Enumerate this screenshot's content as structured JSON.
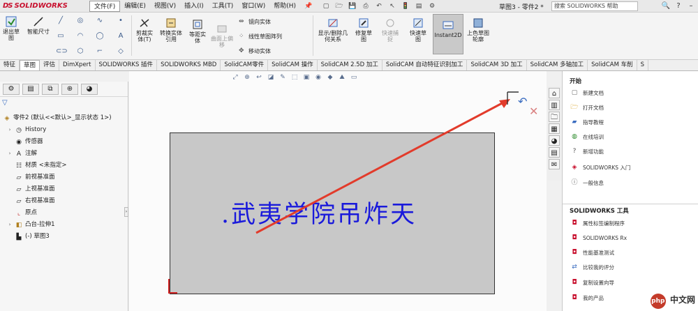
{
  "app": {
    "brand": "SOLIDWORKS",
    "brand_prefix": "DS"
  },
  "menubar": {
    "items": [
      "文件(F)",
      "编辑(E)",
      "视图(V)",
      "插入(I)",
      "工具(T)",
      "窗口(W)",
      "帮助(H)"
    ],
    "doc_title": "草图3 - 零件2 *",
    "search_placeholder": "搜索 SOLIDWORKS 帮助"
  },
  "ribbon": {
    "exit_sketch": "退出草图",
    "smart_dimension": "智能尺寸",
    "trim_entities": "剪裁实体(T)",
    "convert_entities": "转换实体引用",
    "offset_entities": "等距实体",
    "offset_on_surface": "曲面上偏移",
    "mirror_entities": "镜向实体",
    "linear_pattern": "线性草图阵列",
    "move_entities": "移动实体",
    "display_delete_relations": "显示/删除几何关系",
    "repair_sketch": "修复草图",
    "quick_snaps_dim": "快速捕捉",
    "rapid_sketch": "快速草图",
    "instant2d": "Instant2D",
    "shaded_sketch": "上色草图轮廓"
  },
  "cmdtabs": [
    "特征",
    "草图",
    "评估",
    "DimXpert",
    "SOLIDWORKS 插件",
    "SOLIDWORKS MBD",
    "SolidCAM零件",
    "SolidCAM 操作",
    "SolidCAM 2.5D 加工",
    "SolidCAM 自动特征识别加工",
    "SolidCAM 3D 加工",
    "SolidCAM 多轴加工",
    "SolidCAM 车削",
    "S"
  ],
  "active_tab": "草图",
  "tree": {
    "root": "零件2 (默认<<默认>_显示状态 1>)",
    "items": [
      "History",
      "传感器",
      "注解",
      "材质 <未指定>",
      "前视基准面",
      "上视基准面",
      "右视基准面",
      "原点",
      "凸台-拉伸1",
      "(-) 草图3"
    ]
  },
  "sketch": {
    "text": ".武夷学院吊炸天"
  },
  "taskpane": {
    "section_start": "开始",
    "start_items": [
      "新建文档",
      "打开文档",
      "指导教程",
      "在线培训",
      "新增功能",
      "SOLIDWORKS 入门",
      "一般信息"
    ],
    "section_tools": "SOLIDWORKS 工具",
    "tool_items": [
      "属性标签编制程序",
      "SOLIDWORKS Rx",
      "性能基准测试",
      "比较我的评分",
      "复制设置向导",
      "我的产品"
    ]
  },
  "watermark": {
    "badge": "php",
    "text": "中文网"
  },
  "colors": {
    "sketch_text": "#1a1adb",
    "arrow": "#e23b2b",
    "brand_red": "#c8102e"
  }
}
